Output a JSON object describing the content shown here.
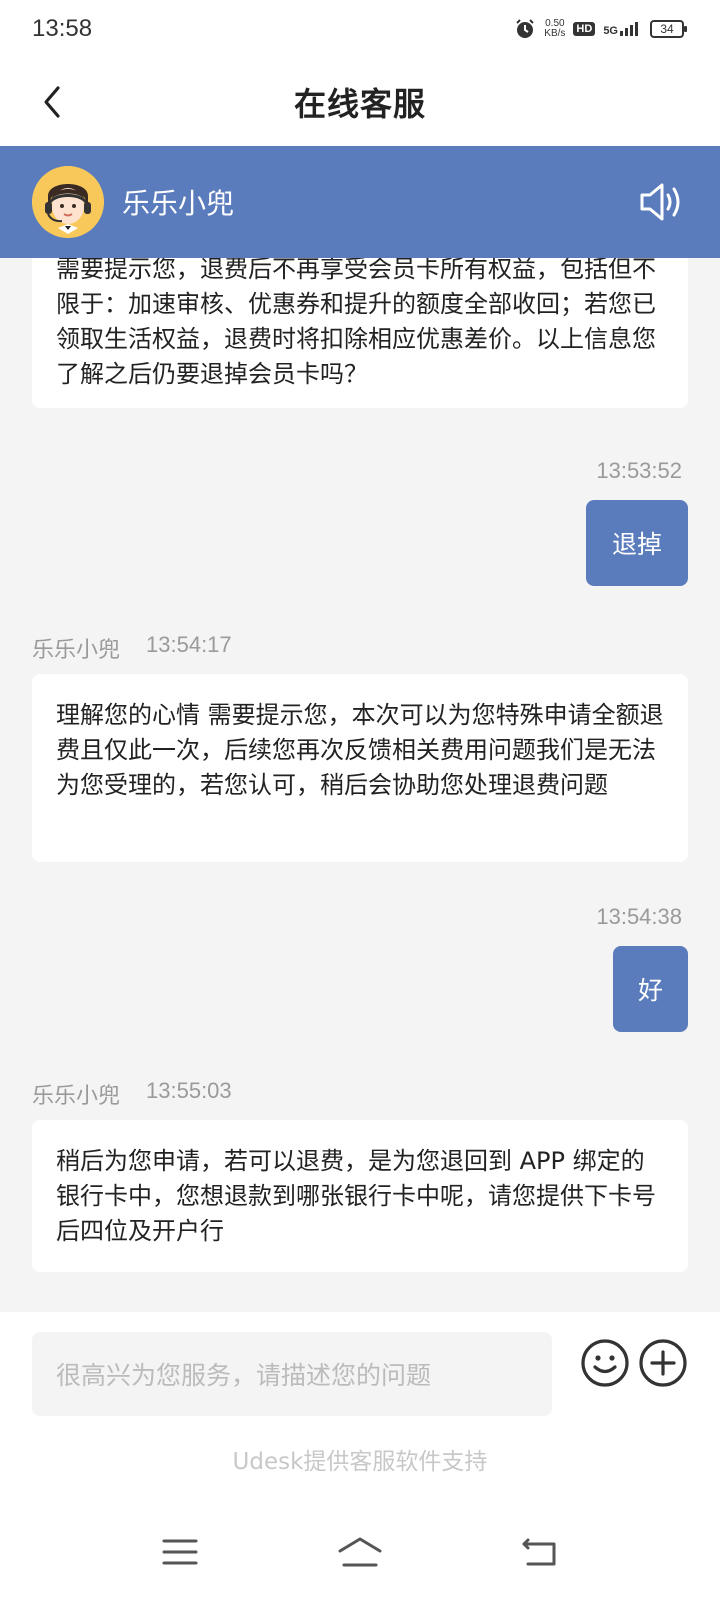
{
  "status_bar": {
    "time": "13:58",
    "speed_value": "0.50",
    "speed_unit": "KB/s",
    "hd": "HD",
    "network": "5G",
    "battery": "34"
  },
  "header": {
    "title": "在线客服"
  },
  "agent": {
    "name": "乐乐小兜"
  },
  "messages": [
    {
      "side": "agent",
      "text": "需要提示您，退费后不再享受会员卡所有权益，包括但不限于：加速审核、优惠券和提升的额度全部收回；若您已领取生活权益，退费时将扣除相应优惠差价。以上信息您了解之后仍要退掉会员卡吗？"
    },
    {
      "side": "user",
      "time": "13:53:52",
      "text": "退掉"
    },
    {
      "side": "agent",
      "sender": "乐乐小兜",
      "time": "13:54:17",
      "text": "理解您的心情 需要提示您，本次可以为您特殊申请全额退费且仅此一次，后续您再次反馈相关费用问题我们是无法为您受理的，若您认可，稍后会协助您处理退费问题"
    },
    {
      "side": "user",
      "time": "13:54:38",
      "text": "好"
    },
    {
      "side": "agent",
      "sender": "乐乐小兜",
      "time": "13:55:03",
      "text": "稍后为您申请，若可以退费，是为您退回到 APP 绑定的银行卡中，您想退款到哪张银行卡中呢，请您提供下卡号后四位及开户行"
    }
  ],
  "input": {
    "placeholder": "很高兴为您服务，请描述您的问题"
  },
  "footer": {
    "powered_by": "Udesk提供客服软件支持"
  },
  "colors": {
    "brand": "#5b7cbc",
    "background": "#f4f4f4"
  },
  "icons": {
    "back": "chevron-left-icon",
    "speaker": "speaker-icon",
    "emoji": "smiley-icon",
    "plus": "plus-circle-icon",
    "nav_menu": "menu-icon",
    "nav_home": "home-icon",
    "nav_back": "back-arrow-icon"
  }
}
